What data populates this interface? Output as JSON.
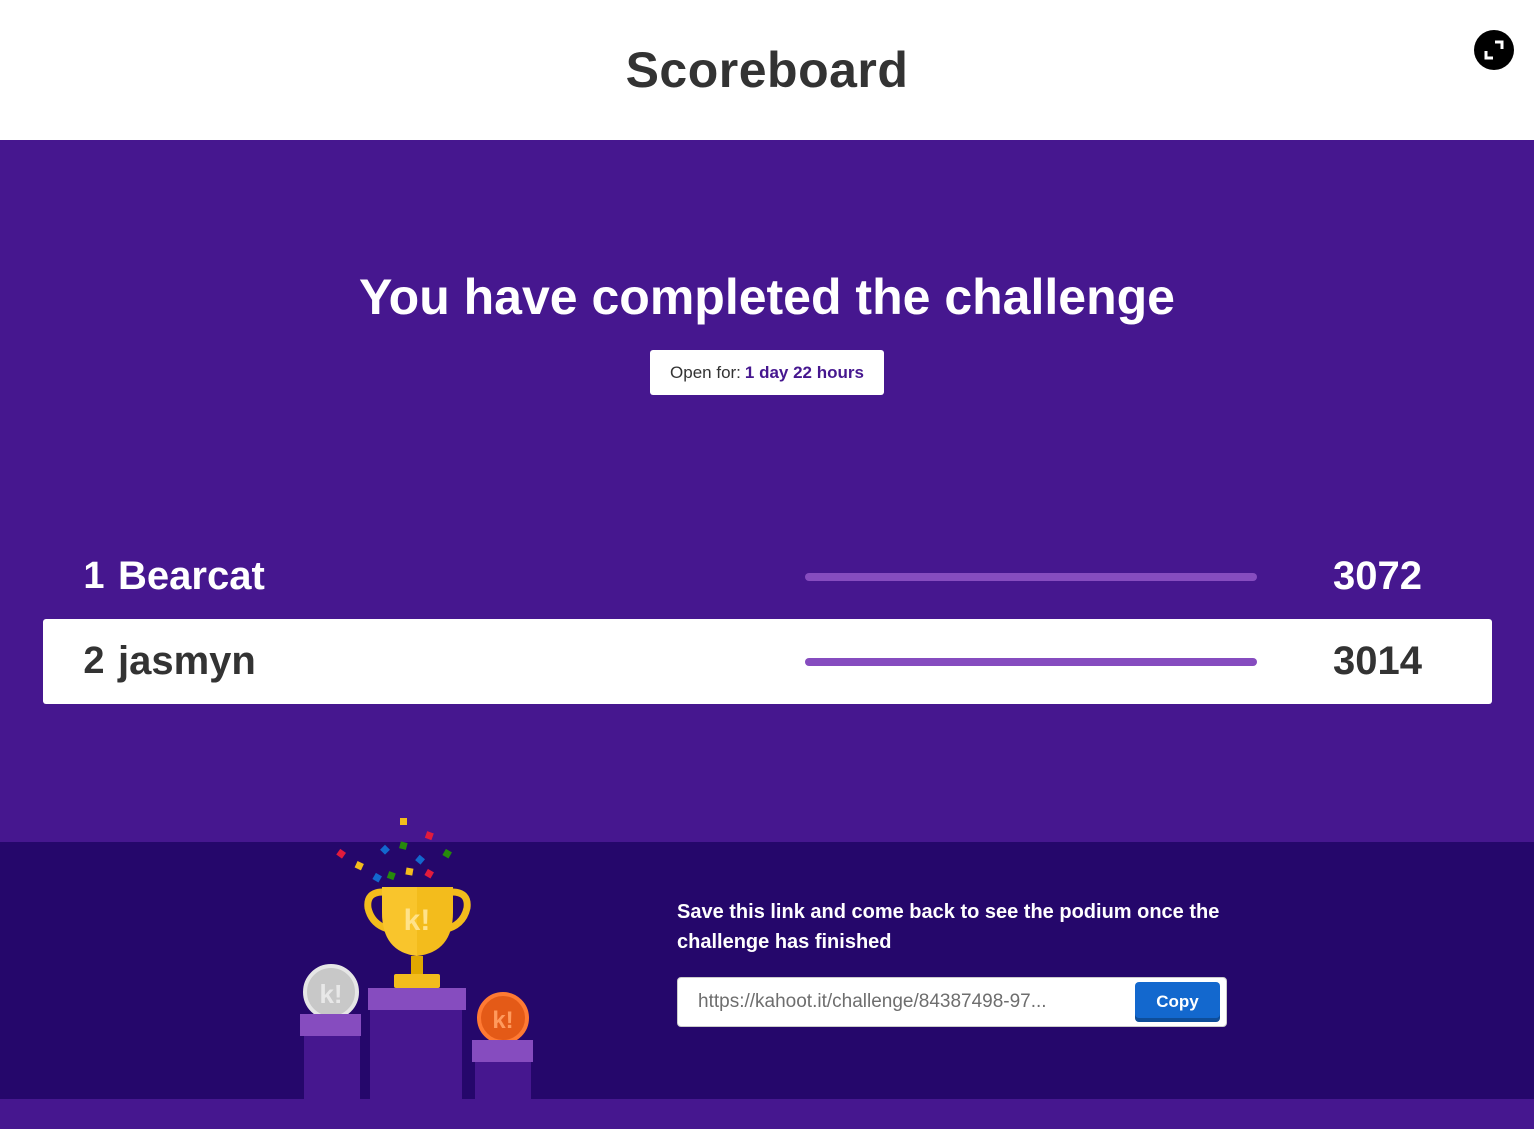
{
  "header": {
    "title": "Scoreboard"
  },
  "main": {
    "headline": "You have completed the challenge",
    "open_for": {
      "label": "Open for:",
      "value": "1 day 22 hours"
    }
  },
  "scoreboard": [
    {
      "rank": "1",
      "name": "Bearcat",
      "score": "3072",
      "progress": 1.0
    },
    {
      "rank": "2",
      "name": "jasmyn",
      "score": "3014",
      "progress": 1.0
    }
  ],
  "footer": {
    "save_text": "Save this link and come back to see the podium once the challenge has finished",
    "link_value": "https://kahoot.it/challenge/84387498-97...",
    "copy_label": "Copy"
  },
  "icons": {
    "fullscreen": "fullscreen-icon",
    "trophy": "trophy-icon"
  },
  "colors": {
    "brand_purple": "#46178f",
    "footer_purple": "#25076b",
    "bar_purple": "#864cbf",
    "copy_blue": "#1368ce",
    "trophy_gold": "#f3bc1c",
    "silver": "#c8c8c8",
    "bronze": "#e45a17"
  }
}
